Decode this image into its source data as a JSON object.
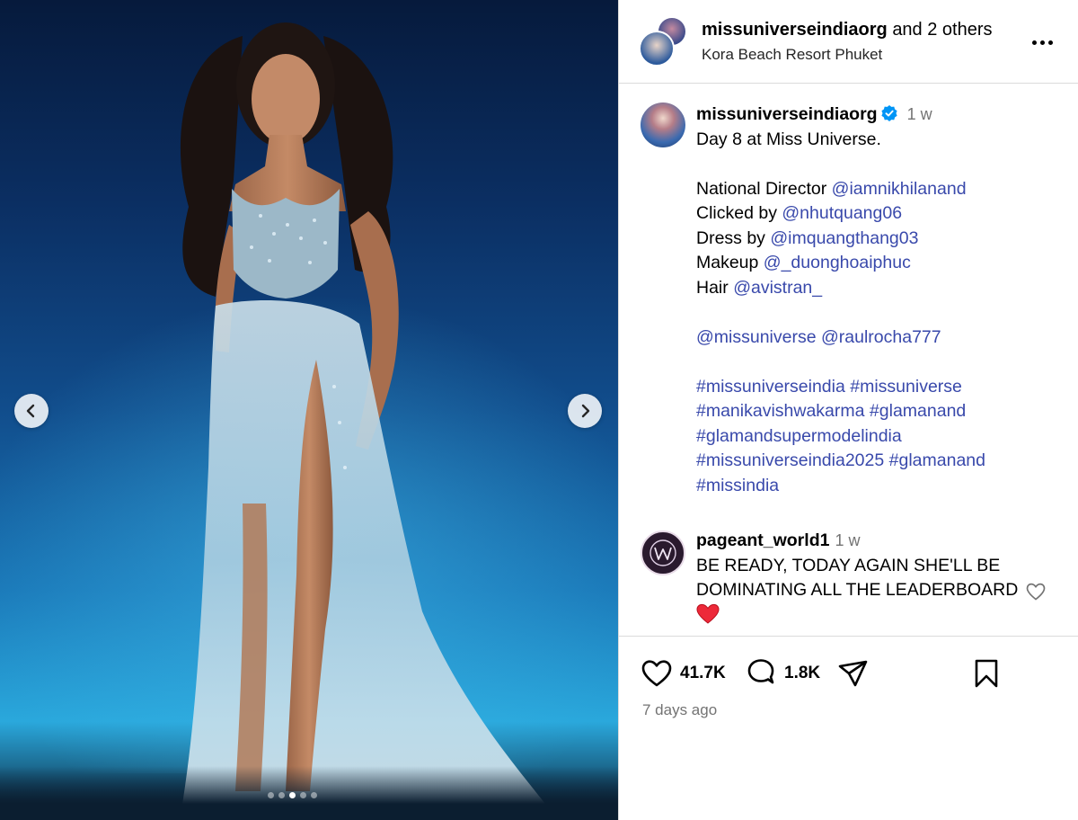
{
  "header": {
    "username": "missuniverseindiaorg",
    "others": "and 2 others",
    "location": "Kora Beach Resort Phuket"
  },
  "caption": {
    "username": "missuniverseindiaorg",
    "time": "1 w",
    "line1": "Day 8 at Miss Universe.",
    "director_label": "National Director",
    "director_handle": "@iamnikhilanand",
    "clicked_label": "Clicked by",
    "clicked_handle": "@nhutquang06",
    "dress_label": "Dress by",
    "dress_handle": "@imquangthang03",
    "makeup_label": "Makeup",
    "makeup_handle": "@_duonghoaiphuc",
    "hair_label": "Hair",
    "hair_handle": "@avistran_",
    "mention1": "@missuniverse",
    "mention2": "@raulrocha777",
    "tags": [
      "#missuniverseindia",
      "#missuniverse",
      "#manikavishwakarma",
      "#glamanand",
      "#glamandsupermodelindia",
      "#missuniverseindia2025",
      "#glamanand",
      "#missindia"
    ]
  },
  "comment": {
    "username": "pageant_world1",
    "time": "1 w",
    "text1": "BE READY, TODAY AGAIN SHE'LL BE",
    "text2": "DOMINATING ALL THE LEADERBOARD",
    "emoji": "❤️"
  },
  "actions": {
    "likes": "41.7K",
    "comments": "1.8K",
    "posted": "7 days ago"
  },
  "carousel": {
    "total": 5,
    "active": 3
  },
  "colors": {
    "link": "#3949ab",
    "verified": "#0095f6",
    "heart": "#ed2939"
  },
  "icons": [
    "chevron-left-icon",
    "chevron-right-icon",
    "more-icon",
    "verified-icon",
    "heart-icon",
    "comment-icon",
    "share-icon",
    "bookmark-icon"
  ]
}
